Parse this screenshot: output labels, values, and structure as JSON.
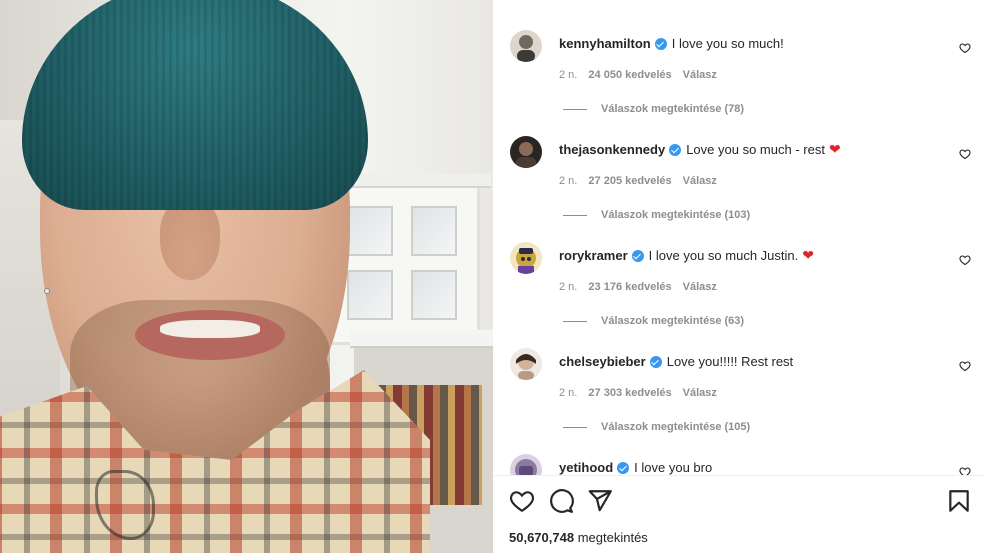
{
  "post": {
    "views_count": "50,670,748",
    "views_label": "megtekintés"
  },
  "comments": [
    {
      "username": "kennyhamilton",
      "verified": true,
      "text": "I love you so much!",
      "emoji": "",
      "age": "2 n.",
      "likes": "24 050 kedvelés",
      "reply": "Válasz",
      "view_replies": "Válaszok megtekintése (78)",
      "avatar_color": "#6f6a60"
    },
    {
      "username": "thejasonkennedy",
      "verified": true,
      "text": "Love you so much - rest",
      "emoji": "red-heart",
      "age": "2 n.",
      "likes": "27 205 kedvelés",
      "reply": "Válasz",
      "view_replies": "Válaszok megtekintése (103)",
      "avatar_color": "#4a3b34"
    },
    {
      "username": "rorykramer",
      "verified": true,
      "text": "I love you so much Justin.",
      "emoji": "red-heart",
      "age": "2 n.",
      "likes": "23 176 kedvelés",
      "reply": "Válasz",
      "view_replies": "Válaszok megtekintése (63)",
      "avatar_color": "#c9a63a"
    },
    {
      "username": "chelseybieber",
      "verified": true,
      "text": "Love you!!!!! Rest rest",
      "emoji": "",
      "age": "2 n.",
      "likes": "27 303 kedvelés",
      "reply": "Válasz",
      "view_replies": "Válaszok megtekintése (105)",
      "avatar_color": "#b89a86"
    },
    {
      "username": "yetihood",
      "verified": true,
      "text": "I love you bro",
      "emoji": "",
      "avatar_color": "#8c7aa0"
    }
  ],
  "icons": {
    "like": "heart-icon",
    "comment": "comment-icon",
    "share": "share-icon",
    "save": "bookmark-icon",
    "verified": "verified-badge-icon"
  },
  "colors": {
    "verified": "#3897f0",
    "secondary_text": "#8e8e8e",
    "heart_emoji": "#e0242a"
  }
}
